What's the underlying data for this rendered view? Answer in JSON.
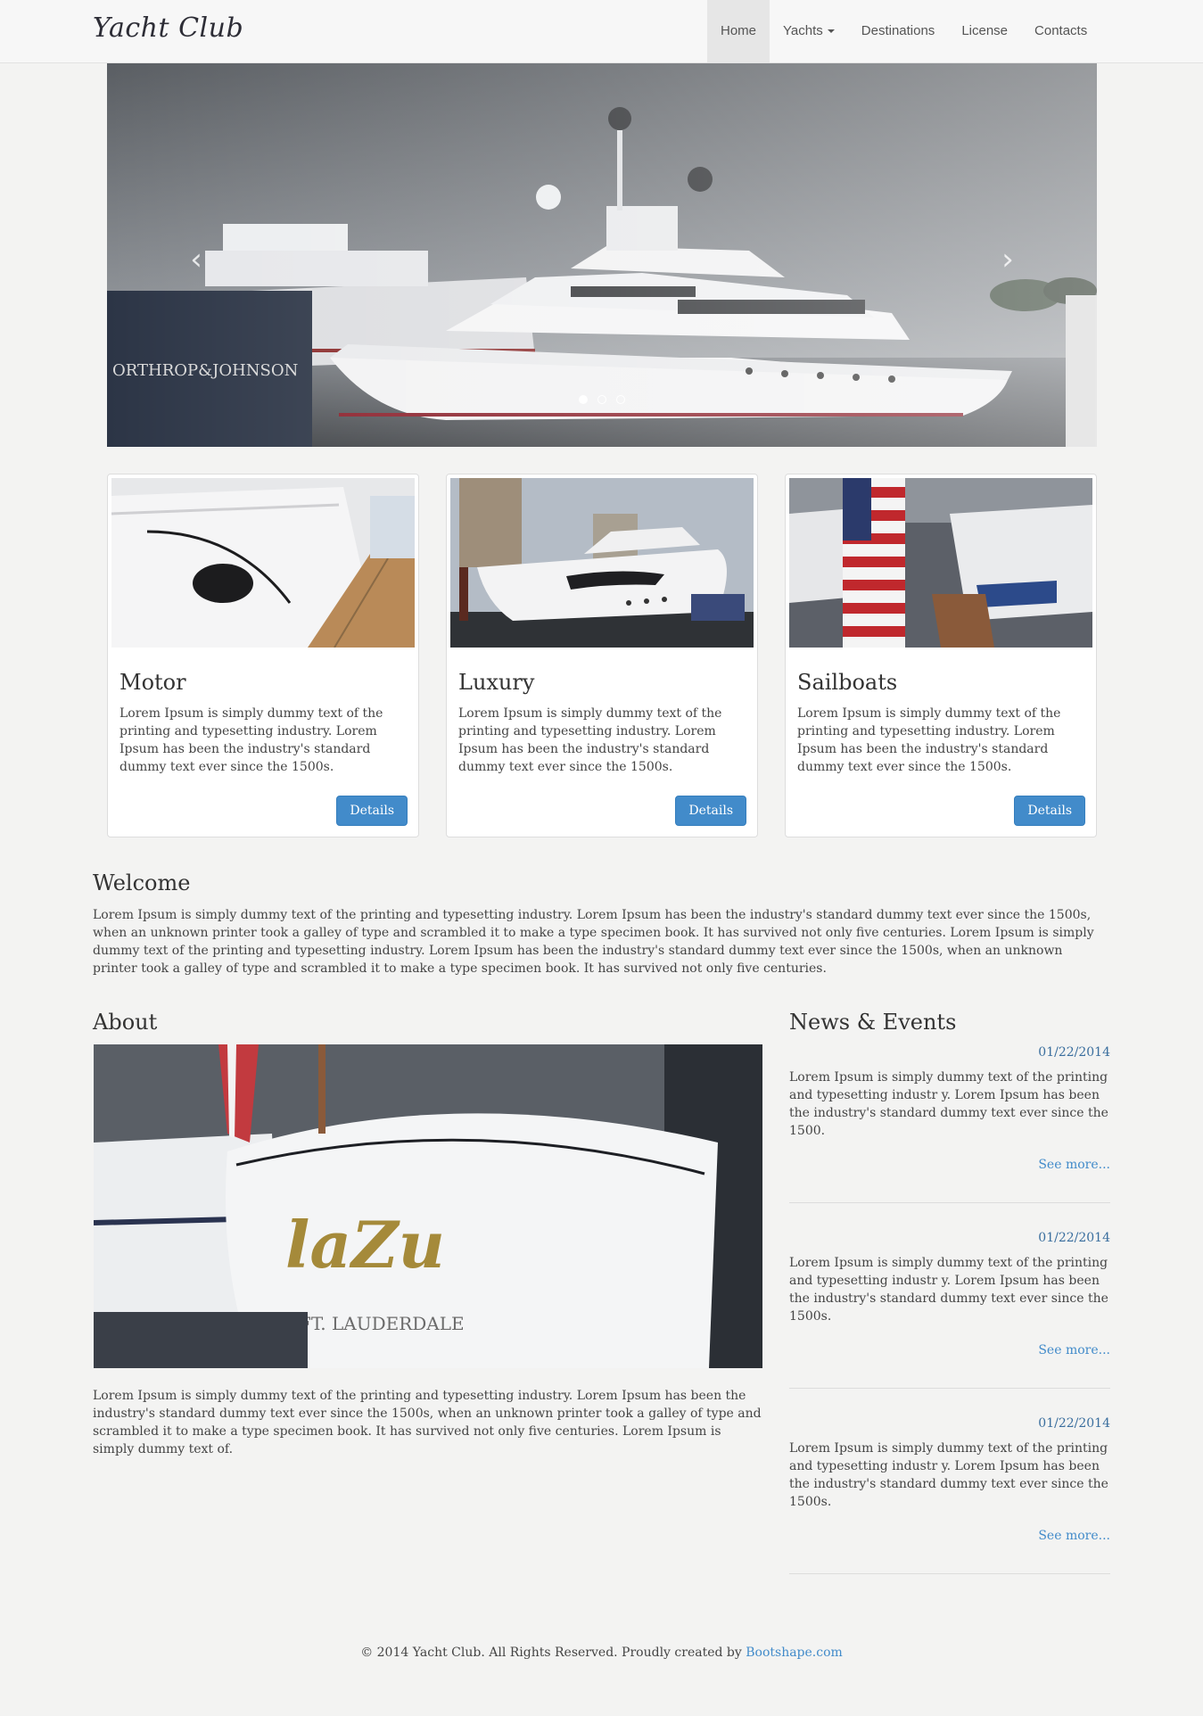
{
  "brand": "Yacht Club",
  "nav": {
    "items": [
      {
        "label": "Home",
        "active": true
      },
      {
        "label": "Yachts",
        "dropdown": true
      },
      {
        "label": "Destinations"
      },
      {
        "label": "License"
      },
      {
        "label": "Contacts"
      }
    ]
  },
  "carousel": {
    "prev_icon": "chevron-left-icon",
    "next_icon": "chevron-right-icon",
    "prev_glyph": "‹",
    "next_glyph": "›",
    "slide_count": 3,
    "active_slide": 1,
    "signage_text": "ORTHROP&JOHNSON"
  },
  "thumbnails": [
    {
      "title": "Motor",
      "text": "Lorem Ipsum is simply dummy text of the printing and typesetting industry. Lorem Ipsum has been the industry's standard dummy text ever since the 1500s.",
      "button": "Details"
    },
    {
      "title": "Luxury",
      "text": "Lorem Ipsum is simply dummy text of the printing and typesetting industry. Lorem Ipsum has been the industry's standard dummy text ever since the 1500s.",
      "button": "Details"
    },
    {
      "title": "Sailboats",
      "text": "Lorem Ipsum is simply dummy text of the printing and typesetting industry. Lorem Ipsum has been the industry's standard dummy text ever since the 1500s.",
      "button": "Details"
    }
  ],
  "welcome": {
    "title": "Welcome",
    "text": "Lorem Ipsum is simply dummy text of the printing and typesetting industry. Lorem Ipsum has been the industry's standard dummy text ever since the 1500s, when an unknown printer took a galley of type and scrambled it to make a type specimen book. It has survived not only five centuries. Lorem Ipsum is simply dummy text of the printing and typesetting industry. Lorem Ipsum has been the industry's standard dummy text ever since the 1500s, when an unknown printer took a galley of type and scrambled it to make a type specimen book. It has survived not only five centuries."
  },
  "about": {
    "title": "About",
    "boat_name": "laZu",
    "boat_port": "FT. LAUDERDALE",
    "text": "Lorem Ipsum is simply dummy text of the printing and typesetting industry. Lorem Ipsum has been the industry's standard dummy text ever since the 1500s, when an unknown printer took a galley of type and scrambled it to make a type specimen book. It has survived not only five centuries. Lorem Ipsum is simply dummy text of."
  },
  "news": {
    "title": "News & Events",
    "items": [
      {
        "date": "01/22/2014",
        "text": "Lorem Ipsum is simply dummy text of the printing and typesetting industr y. Lorem Ipsum has been the industry's standard dummy text ever since the 1500.",
        "more": "See more..."
      },
      {
        "date": "01/22/2014",
        "text": "Lorem Ipsum is simply dummy text of the printing and typesetting industr y. Lorem Ipsum has been the industry's standard dummy text ever since the 1500s.",
        "more": "See more..."
      },
      {
        "date": "01/22/2014",
        "text": "Lorem Ipsum is simply dummy text of the printing and typesetting industr y. Lorem Ipsum has been the industry's standard dummy text ever since the 1500s.",
        "more": "See more..."
      }
    ]
  },
  "footer": {
    "text": "© 2014 Yacht Club. All Rights Reserved. Proudly created by ",
    "link": "Bootshape.com"
  },
  "colors": {
    "accent": "#428bca",
    "background": "#f3f3f2",
    "navbar": "#f7f7f7"
  }
}
